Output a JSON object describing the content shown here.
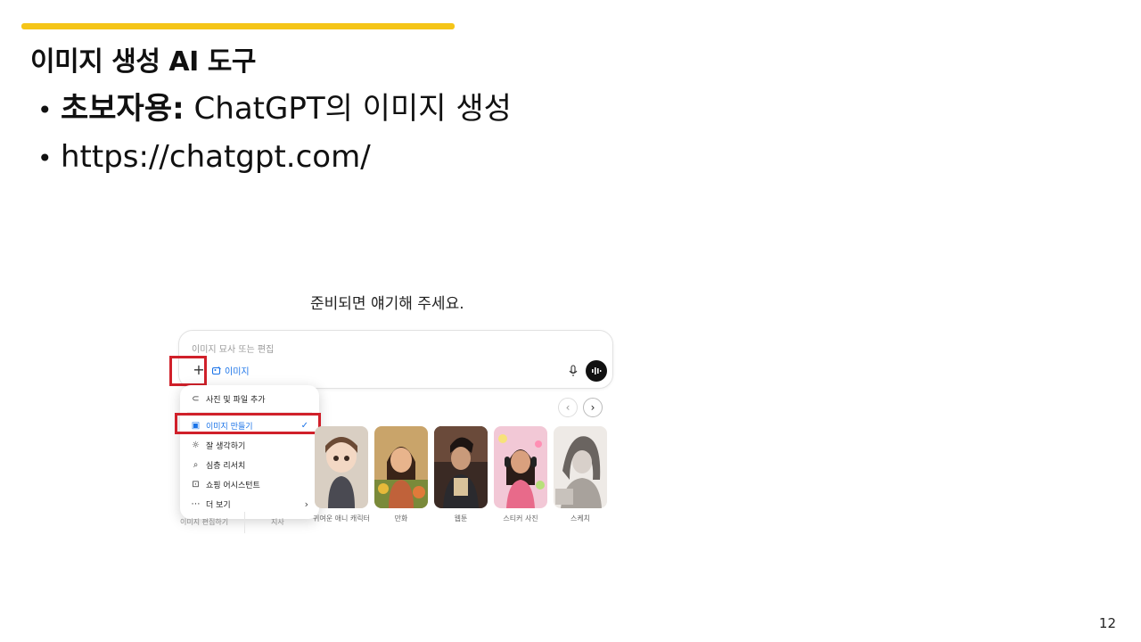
{
  "slide": {
    "title": "이미지 생성 AI 도구",
    "bullet1_bold": "초보자용:",
    "bullet1_rest": " ChatGPT의 이미지 생성",
    "bullet2": "https://chatgpt.com/",
    "page_number": "12",
    "accent_color": "#f5c518"
  },
  "screenshot": {
    "headline": "준비되면 얘기해 주세요.",
    "composer_placeholder": "이미지 묘사 또는 편집",
    "plus_label": "+",
    "chip_label": "이미지",
    "menu": [
      {
        "label": "사진 및 파일 추가",
        "icon": "paperclip-icon"
      },
      {
        "label": "이미지 만들기",
        "icon": "image-create-icon",
        "selected": true
      },
      {
        "label": "잘 생각하기",
        "icon": "lightbulb-icon"
      },
      {
        "label": "심층 리서치",
        "icon": "telescope-icon"
      },
      {
        "label": "쇼핑 어시스턴트",
        "icon": "shopping-bag-icon"
      },
      {
        "label": "더 보기",
        "icon": "more-icon",
        "has_submenu": true
      }
    ],
    "styles": [
      {
        "label": "귀여운 애니 캐릭터"
      },
      {
        "label": "만화"
      },
      {
        "label": "웹툰"
      },
      {
        "label": "스티커 사진"
      },
      {
        "label": "스케치"
      }
    ],
    "under_labels": [
      "이미지 편집하기",
      "지사"
    ],
    "highlight_color": "#d0202a",
    "link_color": "#1a73e8"
  }
}
